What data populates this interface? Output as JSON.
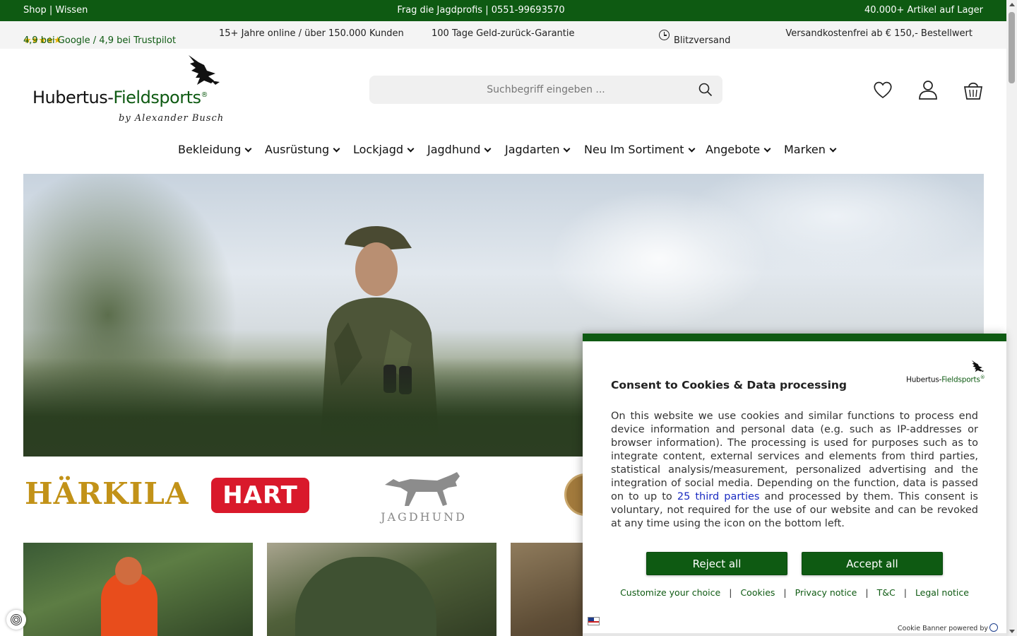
{
  "topbar": {
    "left": "Shop | Wissen",
    "center": "Frag die Jagdprofis | 0551-99693570",
    "right": "40.000+ Artikel auf Lager"
  },
  "usp": {
    "stars": "★★★★★",
    "rating": "4,9 bei Google / 4,9 bei Trustpilot",
    "years": "15+ Jahre online / über 150.000 Kunden",
    "money_back": "100 Tage Geld-zurück-Garantie",
    "shipping_fast": "Blitzversand",
    "free_shipping": "Versandkostenfrei ab € 150,- Bestellwert"
  },
  "logo": {
    "name_a": "Hubertus-",
    "name_b": "Fieldsports",
    "reg": "®",
    "byline": "by Alexander Busch"
  },
  "search": {
    "placeholder": "Suchbegriff eingeben ..."
  },
  "icons": {
    "search": "search-icon",
    "wishlist": "heart-icon",
    "account": "user-icon",
    "cart": "basket-icon"
  },
  "nav": {
    "items": [
      {
        "label": "Bekleidung"
      },
      {
        "label": "Ausrüstung"
      },
      {
        "label": "Lockjagd"
      },
      {
        "label": "Jagdhund"
      },
      {
        "label": "Jagdarten"
      },
      {
        "label": "Neu Im Sortiment"
      },
      {
        "label": "Angebote"
      },
      {
        "label": "Marken"
      }
    ]
  },
  "brands": {
    "harkila": "HÄRKILA",
    "hart": "HART",
    "jagdhund": "JAGDHUND"
  },
  "cookie": {
    "title": "Consent to Cookies & Data processing",
    "logo_a": "Hubertus-",
    "logo_b": "Fieldsports",
    "logo_reg": "®",
    "body_1": "On this website we use cookies and similar functions to process end device information and personal data (e.g. such as IP-addresses or browser information). The processing is used for purposes such as to integrate content, external services and elements from third parties, statistical analysis/measurement, personalized advertising and the integration of social media. Depending on the function, data is passed on to up to ",
    "body_link": "25 third parties",
    "body_2": " and processed by them. This consent is voluntary, not required for the use of our website and can be revoked at any time using the icon on the bottom left.",
    "reject": "Reject all",
    "accept": "Accept all",
    "links": {
      "customize": "Customize your choice",
      "cookies": "Cookies",
      "privacy": "Privacy notice",
      "tc": "T&C",
      "legal": "Legal notice",
      "sep": "|"
    },
    "powered": "Cookie Banner powered by"
  },
  "colors": {
    "brand_green": "#0e5a12",
    "hart_red": "#d9192b",
    "harkila_gold": "#c29218",
    "link_blue": "#1a2bc2"
  }
}
